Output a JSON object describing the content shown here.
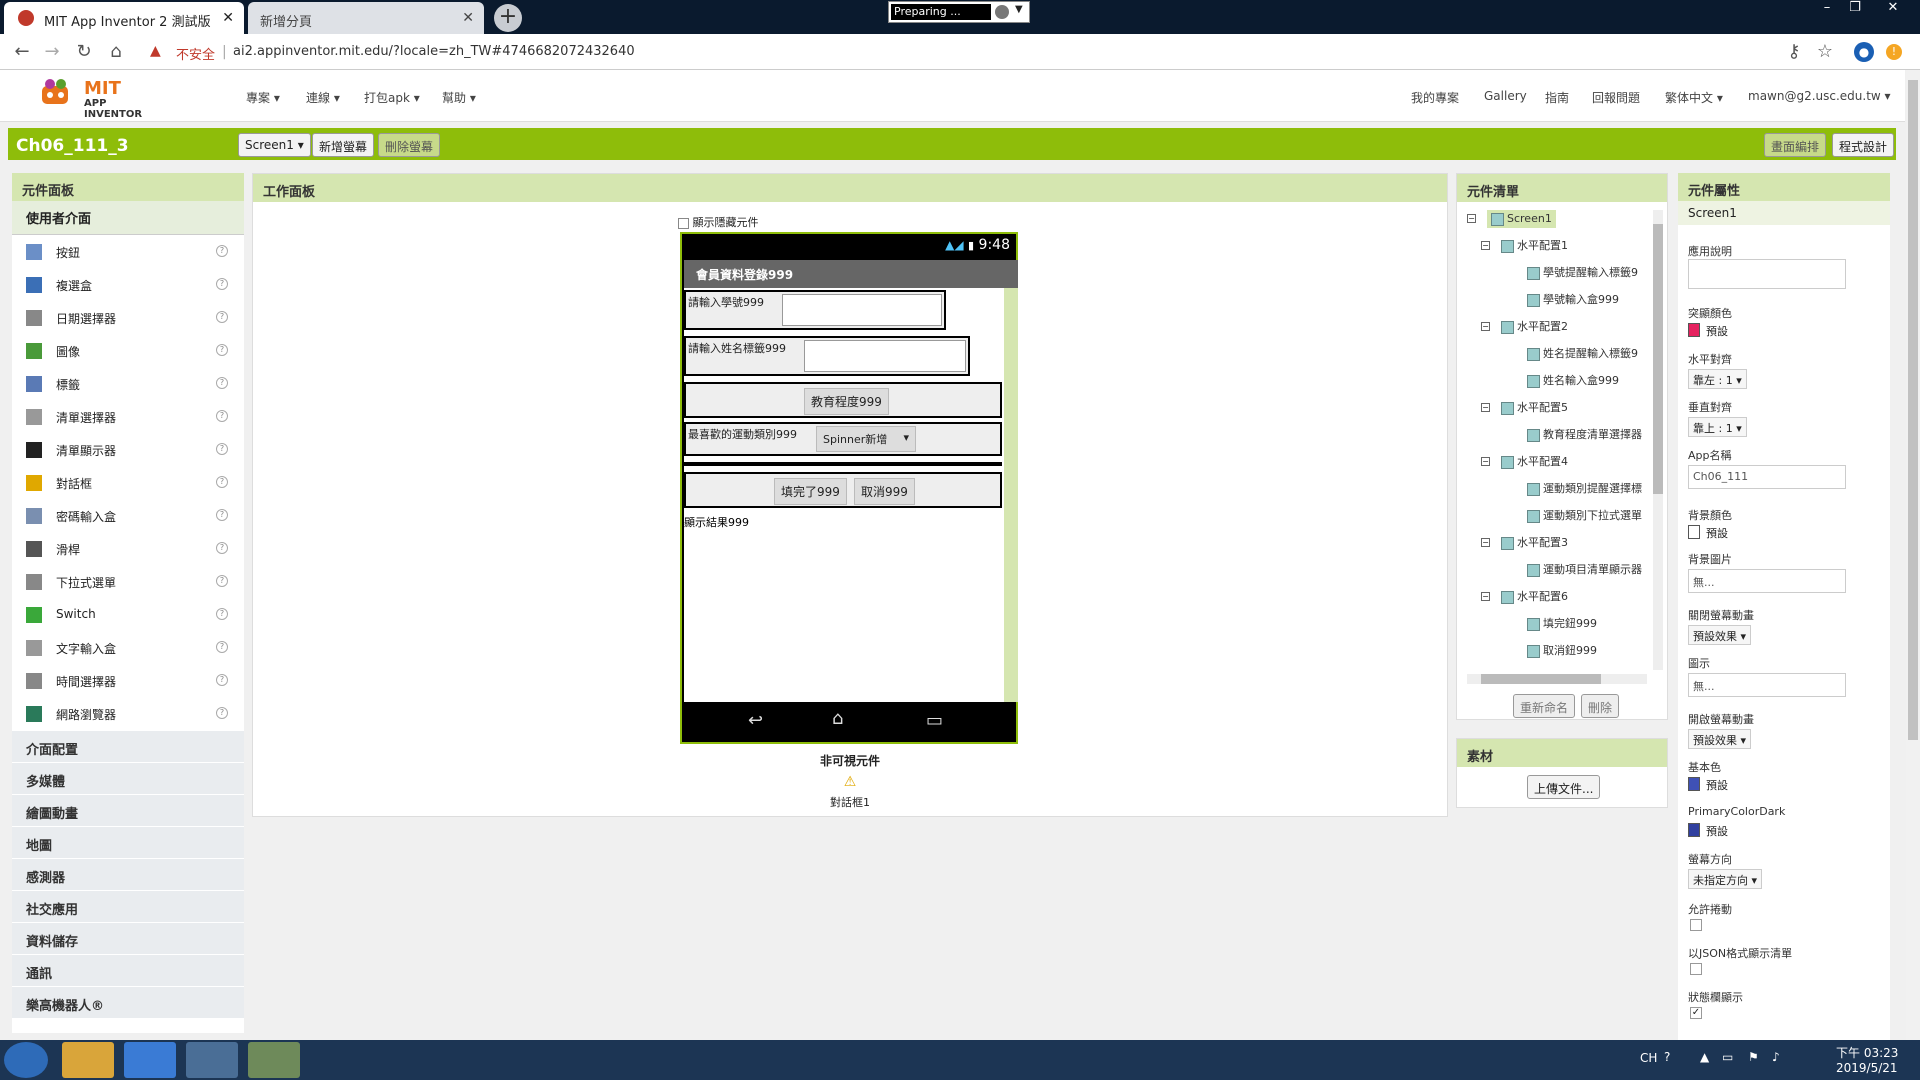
{
  "browser": {
    "tabs": [
      {
        "title": "MIT App Inventor 2 測試版",
        "active": true
      },
      {
        "title": "新增分頁",
        "active": false
      }
    ],
    "status_widget": "Preparing ...",
    "url_warning": "不安全",
    "url": "ai2.appinventor.mit.edu/?locale=zh_TW#4746682072432640"
  },
  "header": {
    "logo_mit": "MIT",
    "logo_app": "APP INVENTOR",
    "menu": [
      "專案 ▾",
      "連線 ▾",
      "打包apk ▾",
      "幫助 ▾"
    ],
    "right_menu": [
      "我的專案",
      "Gallery",
      "指南",
      "回報問題",
      "繁体中文 ▾",
      "mawn@g2.usc.edu.tw ▾"
    ]
  },
  "toolbar": {
    "project_name": "Ch06_111_3",
    "screen_select": "Screen1 ▾",
    "add_screen": "新增螢幕",
    "remove_screen": "刪除螢幕",
    "designer": "畫面編排",
    "blocks": "程式設計"
  },
  "palette": {
    "title": "元件面板",
    "section": "使用者介面",
    "items": [
      "按鈕",
      "複選盒",
      "日期選擇器",
      "圖像",
      "標籤",
      "清單選擇器",
      "清單顯示器",
      "對話框",
      "密碼輸入盒",
      "滑桿",
      "下拉式選單",
      "Switch",
      "文字輸入盒",
      "時間選擇器",
      "網路瀏覽器"
    ],
    "categories": [
      "介面配置",
      "多媒體",
      "繪圖動畫",
      "地圖",
      "感測器",
      "社交應用",
      "資料儲存",
      "通訊",
      "樂高機器人®"
    ]
  },
  "viewer": {
    "title": "工作面板",
    "show_hidden": "顯示隱藏元件",
    "clock": "9:48",
    "app_title": "會員資料登錄999",
    "label_id": "請輸入學號999",
    "label_name": "請輸入姓名標籤999",
    "edu_button": "教育程度999",
    "sport_label": "最喜歡的運動類別999",
    "spinner": "Spinner新增",
    "ok_button": "填完了999",
    "cancel_button": "取消999",
    "result_label": "顯示結果999",
    "nonvisible_title": "非可視元件",
    "nonvisible_item": "對話框1"
  },
  "components": {
    "title": "元件清單",
    "nodes": [
      {
        "label": "Screen1",
        "level": 0
      },
      {
        "label": "水平配置1",
        "level": 1
      },
      {
        "label": "學號提醒輸入標籤9",
        "level": 2
      },
      {
        "label": "學號輸入盒999",
        "level": 2
      },
      {
        "label": "水平配置2",
        "level": 1
      },
      {
        "label": "姓名提醒輸入標籤9",
        "level": 2
      },
      {
        "label": "姓名輸入盒999",
        "level": 2
      },
      {
        "label": "水平配置5",
        "level": 1
      },
      {
        "label": "教育程度清單選擇器",
        "level": 2
      },
      {
        "label": "水平配置4",
        "level": 1
      },
      {
        "label": "運動類別提醒選擇標",
        "level": 2
      },
      {
        "label": "運動類別下拉式選單",
        "level": 2
      },
      {
        "label": "水平配置3",
        "level": 1
      },
      {
        "label": "運動項目清單顯示器",
        "level": 2
      },
      {
        "label": "水平配置6",
        "level": 1
      },
      {
        "label": "填完鈕999",
        "level": 2
      },
      {
        "label": "取消鈕999",
        "level": 2
      }
    ],
    "rename": "重新命名",
    "delete": "刪除"
  },
  "media": {
    "title": "素材",
    "upload": "上傳文件..."
  },
  "properties": {
    "title": "元件屬性",
    "component": "Screen1",
    "about_label": "應用說明",
    "accent_label": "突顯顏色",
    "accent_value": "預設",
    "accent_color": "#e5225f",
    "halign_label": "水平對齊",
    "halign_value": "靠左 : 1 ▾",
    "valign_label": "垂直對齊",
    "valign_value": "靠上 : 1 ▾",
    "appname_label": "App名稱",
    "appname_value": "Ch06_111",
    "bgcolor_label": "背景顏色",
    "bgcolor_value": "預設",
    "bgimage_label": "背景圖片",
    "bgimage_value": "無...",
    "close_anim_label": "關閉螢幕動畫",
    "close_anim_value": "預設效果 ▾",
    "icon_label": "圖示",
    "icon_value": "無...",
    "open_anim_label": "開啟螢幕動畫",
    "open_anim_value": "預設效果 ▾",
    "primary_label": "基本色",
    "primary_value": "預設",
    "primary_color": "#3f51b5",
    "primary_dark_label": "PrimaryColorDark",
    "primary_dark_value": "預設",
    "primary_dark_color": "#303f9f",
    "orientation_label": "螢幕方向",
    "orientation_value": "未指定方向 ▾",
    "scrollable_label": "允許捲動",
    "json_label": "以JSON格式顯示清單",
    "statusbar_label": "狀態欄顯示"
  },
  "taskbar": {
    "lang": "CH",
    "time": "下午 03:23",
    "date": "2019/5/21"
  }
}
